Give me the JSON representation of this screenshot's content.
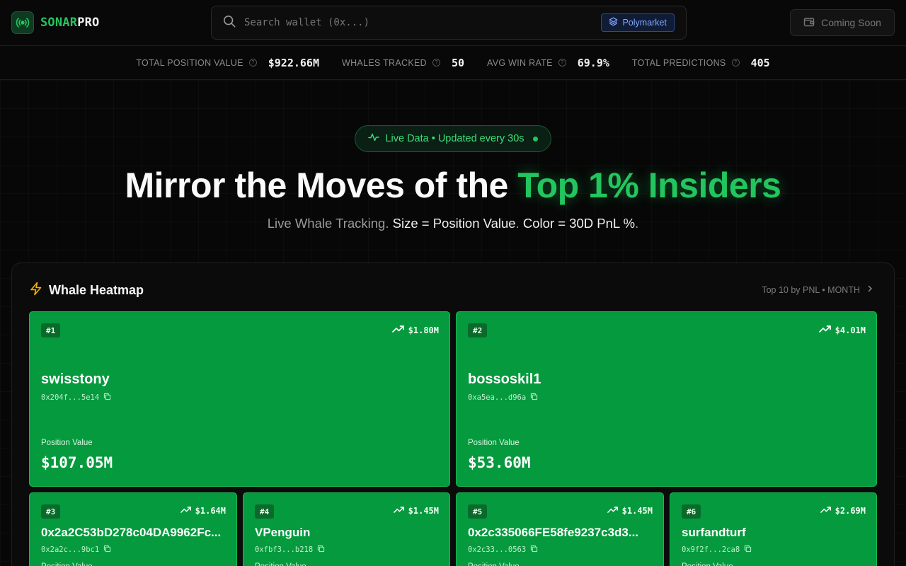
{
  "brand": {
    "name_a": "SONAR",
    "name_b": "PRO"
  },
  "search": {
    "placeholder": "Search wallet (0x...)",
    "badge": "Polymarket"
  },
  "header": {
    "coming_soon": "Coming Soon"
  },
  "stats": [
    {
      "label": "TOTAL POSITION VALUE",
      "value": "$922.66M"
    },
    {
      "label": "WHALES TRACKED",
      "value": "50"
    },
    {
      "label": "AVG WIN RATE",
      "value": "69.9%"
    },
    {
      "label": "TOTAL PREDICTIONS",
      "value": "405"
    }
  ],
  "hero": {
    "pill": "Live Data • Updated every 30s",
    "title_a": "Mirror the Moves of the ",
    "title_b": "Top 1% Insiders",
    "sub_a": "Live Whale Tracking. ",
    "sub_b": "Size = Position Value",
    "sub_c": ". ",
    "sub_d": "Color = 30D PnL %",
    "sub_e": "."
  },
  "heatmap": {
    "title": "Whale Heatmap",
    "meta": "Top 10 by PNL • MONTH",
    "position_label": "Position Value",
    "tiles": [
      {
        "rank": "#1",
        "pnl": "$1.80M",
        "name": "swisstony",
        "addr": "0x204f...5e14",
        "value": "$107.05M"
      },
      {
        "rank": "#2",
        "pnl": "$4.01M",
        "name": "bossoskil1",
        "addr": "0xa5ea...d96a",
        "value": "$53.60M"
      },
      {
        "rank": "#3",
        "pnl": "$1.64M",
        "name": "0x2a2C53bD278c04DA9962Fc...",
        "addr": "0x2a2c...9bc1",
        "value": ""
      },
      {
        "rank": "#4",
        "pnl": "$1.45M",
        "name": "VPenguin",
        "addr": "0xfbf3...b218",
        "value": ""
      },
      {
        "rank": "#5",
        "pnl": "$1.45M",
        "name": "0x2c335066FE58fe9237c3d3...",
        "addr": "0x2c33...0563",
        "value": ""
      },
      {
        "rank": "#6",
        "pnl": "$2.69M",
        "name": "surfandturf",
        "addr": "0x9f2f...2ca8",
        "value": ""
      }
    ]
  }
}
